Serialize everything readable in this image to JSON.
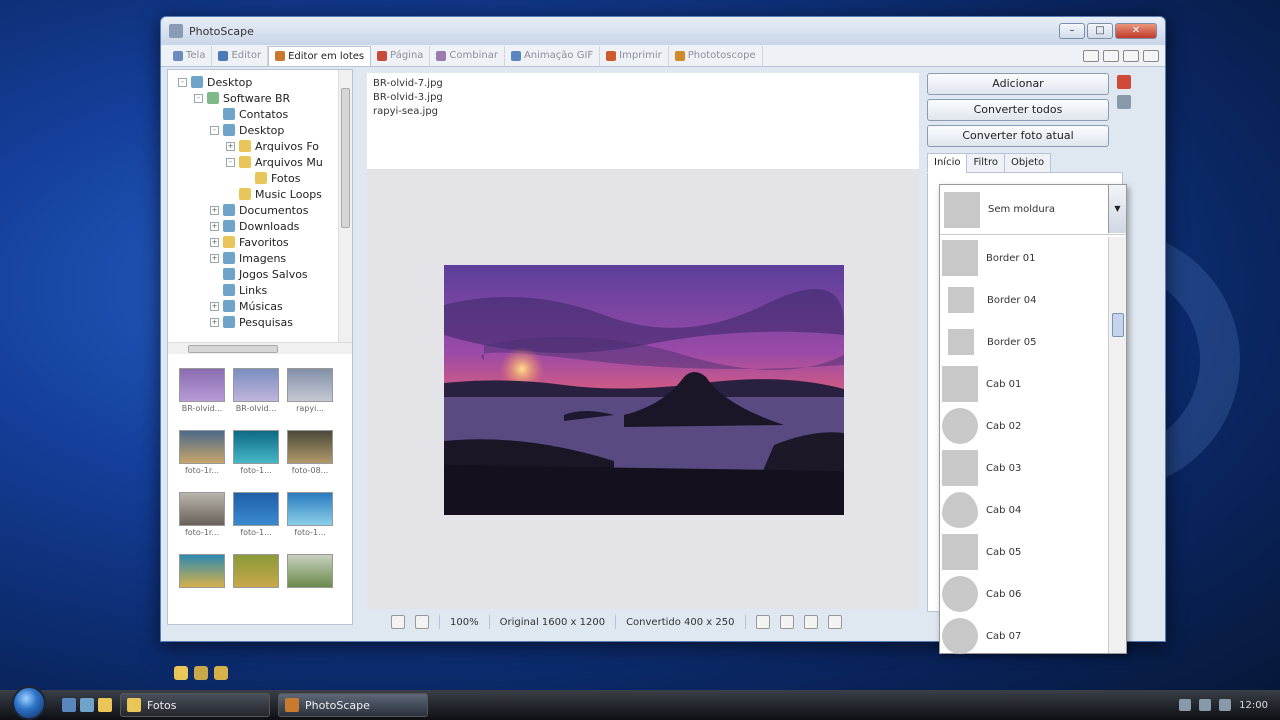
{
  "window": {
    "title": "PhotoScape"
  },
  "tabs": [
    {
      "label": "Tela",
      "color": "#6d8bbf",
      "active": false
    },
    {
      "label": "Editor",
      "color": "#4a7ab8",
      "active": false
    },
    {
      "label": "Editor em lotes",
      "color": "#c97a2e",
      "active": true
    },
    {
      "label": "Página",
      "color": "#c94a3a",
      "active": false
    },
    {
      "label": "Combinar",
      "color": "#9a7ab0",
      "active": false
    },
    {
      "label": "Animação GIF",
      "color": "#5a86c0",
      "active": false
    },
    {
      "label": "Imprimir",
      "color": "#d05a2a",
      "active": false
    },
    {
      "label": "Phototoscope",
      "color": "#d08a2a",
      "active": false
    }
  ],
  "tree": [
    {
      "label": "Desktop",
      "level": 0,
      "icon": "blue",
      "exp": "-"
    },
    {
      "label": "Software BR",
      "level": 1,
      "icon": "green",
      "exp": "-"
    },
    {
      "label": "Contatos",
      "level": 2,
      "icon": "blue",
      "exp": ""
    },
    {
      "label": "Desktop",
      "level": 2,
      "icon": "blue",
      "exp": "-"
    },
    {
      "label": "Arquivos Fo",
      "level": 3,
      "icon": "yellow",
      "exp": "+"
    },
    {
      "label": "Arquivos Mu",
      "level": 3,
      "icon": "yellow",
      "exp": "-"
    },
    {
      "label": "Fotos",
      "level": 4,
      "icon": "yellow",
      "exp": ""
    },
    {
      "label": "Music Loops",
      "level": 3,
      "icon": "yellow",
      "exp": ""
    },
    {
      "label": "Documentos",
      "level": 2,
      "icon": "blue",
      "exp": "+"
    },
    {
      "label": "Downloads",
      "level": 2,
      "icon": "blue",
      "exp": "+"
    },
    {
      "label": "Favoritos",
      "level": 2,
      "icon": "yellow",
      "exp": "+"
    },
    {
      "label": "Imagens",
      "level": 2,
      "icon": "blue",
      "exp": "+"
    },
    {
      "label": "Jogos Salvos",
      "level": 2,
      "icon": "blue",
      "exp": ""
    },
    {
      "label": "Links",
      "level": 2,
      "icon": "blue",
      "exp": ""
    },
    {
      "label": "Músicas",
      "level": 2,
      "icon": "blue",
      "exp": "+"
    },
    {
      "label": "Pesquisas",
      "level": 2,
      "icon": "blue",
      "exp": "+"
    }
  ],
  "thumbnails": [
    {
      "caption": "BR-olvid...",
      "top": "#8a6db0",
      "bottom": "#b99ad8"
    },
    {
      "caption": "BR-olvid...",
      "top": "#7a8ec0",
      "bottom": "#c0b4dc"
    },
    {
      "caption": "rapyi...",
      "top": "#8390a8",
      "bottom": "#c5c8d4"
    },
    {
      "caption": "foto-1r...",
      "top": "#4c6a8a",
      "bottom": "#c7a56a"
    },
    {
      "caption": "foto-1...",
      "top": "#0d6a84",
      "bottom": "#46b8c8"
    },
    {
      "caption": "foto-08...",
      "top": "#4a4a3a",
      "bottom": "#b39a6a"
    },
    {
      "caption": "foto-1r...",
      "top": "#b8b4ac",
      "bottom": "#6a625a"
    },
    {
      "caption": "foto-1...",
      "top": "#1f5fa8",
      "bottom": "#3a8ad0"
    },
    {
      "caption": "foto-1...",
      "top": "#2a7ac0",
      "bottom": "#8ad0e8"
    },
    {
      "caption": "",
      "top": "#2d8ab0",
      "bottom": "#d6b04a"
    },
    {
      "caption": "",
      "top": "#8a9a3a",
      "bottom": "#c9a84a"
    },
    {
      "caption": "",
      "top": "#c8d0c0",
      "bottom": "#6a8a4a"
    }
  ],
  "files": [
    "BR-olvid-7.jpg",
    "BR-olvid-3.jpg",
    "rapyi-sea.jpg"
  ],
  "status": {
    "zoom": "100%",
    "original": "Original 1600 x 1200",
    "converted": "Convertido 400 x 250"
  },
  "actions": {
    "add": "Adicionar",
    "convert_all": "Converter todos",
    "convert_current": "Converter foto atual"
  },
  "right_tabs": [
    {
      "label": "Início",
      "active": true
    },
    {
      "label": "Filtro",
      "active": false
    },
    {
      "label": "Objeto",
      "active": false
    }
  ],
  "frame_select": {
    "selected": "Sem moldura",
    "options": [
      {
        "label": "Border 01",
        "shape": "square"
      },
      {
        "label": "Border 04",
        "shape": "small"
      },
      {
        "label": "Border 05",
        "shape": "small"
      },
      {
        "label": "Cab 01",
        "shape": "square"
      },
      {
        "label": "Cab 02",
        "shape": "round"
      },
      {
        "label": "Cab 03",
        "shape": "square"
      },
      {
        "label": "Cab 04",
        "shape": "heart"
      },
      {
        "label": "Cab 05",
        "shape": "square"
      },
      {
        "label": "Cab 06",
        "shape": "round"
      },
      {
        "label": "Cab 07",
        "shape": "round"
      }
    ]
  },
  "taskbar": {
    "buttons": [
      {
        "label": "Fotos",
        "icon_color": "#e9c657",
        "active": false
      },
      {
        "label": "PhotoScape",
        "icon_color": "#c97a2e",
        "active": true
      }
    ],
    "clock": "12:00"
  }
}
